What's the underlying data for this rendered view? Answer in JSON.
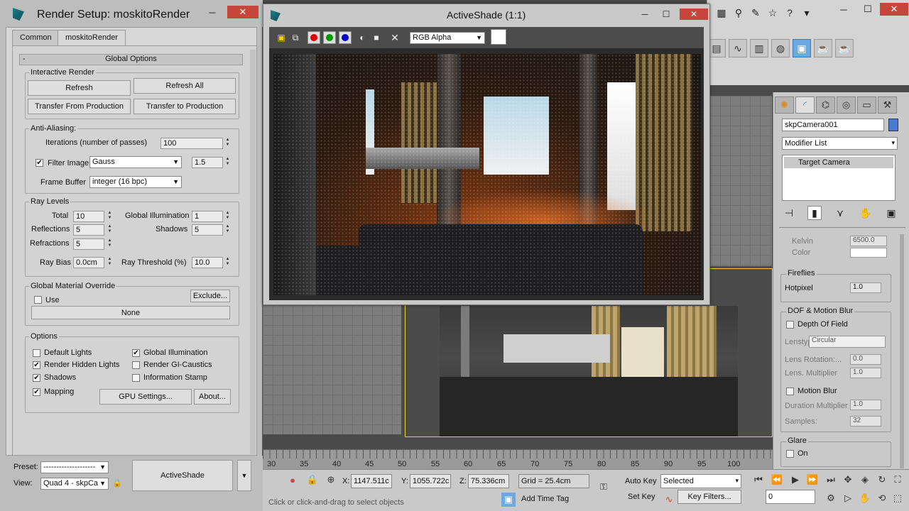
{
  "render_setup": {
    "title": "Render Setup: moskitoRender",
    "tabs": [
      "Common",
      "moskitoRender"
    ],
    "rollout_title": "Global Options",
    "interactive_render": {
      "title": "Interactive Render",
      "refresh": "Refresh",
      "refresh_all": "Refresh All",
      "transfer_from": "Transfer From Production",
      "transfer_to": "Transfer to Production"
    },
    "anti_aliasing": {
      "title": "Anti-Aliasing:",
      "iterations_label": "Iterations (number of passes)",
      "iterations_value": "100",
      "filter_image_label": "Filter Image",
      "filter_value": "Gauss",
      "filter_size": "1.5",
      "frame_buffer_label": "Frame Buffer",
      "frame_buffer_value": "integer (16 bpc)"
    },
    "ray_levels": {
      "title": "Ray Levels",
      "total_label": "Total",
      "total_value": "10",
      "gi_label": "Global Illumination",
      "gi_value": "1",
      "reflections_label": "Reflections",
      "reflections_value": "5",
      "shadows_label": "Shadows",
      "shadows_value": "5",
      "refractions_label": "Refractions",
      "refractions_value": "5",
      "ray_bias_label": "Ray Bias",
      "ray_bias_value": "0.0cm",
      "ray_threshold_label": "Ray Threshold (%)",
      "ray_threshold_value": "10.0"
    },
    "material_override": {
      "title": "Global Material Override",
      "exclude": "Exclude...",
      "use_label": "Use",
      "none_button": "None"
    },
    "options": {
      "title": "Options",
      "default_lights": "Default Lights",
      "global_illumination": "Global Illumination",
      "render_hidden_lights": "Render Hidden Lights",
      "render_gi_caustics": "Render GI-Caustics",
      "shadows": "Shadows",
      "information_stamp": "Information Stamp",
      "mapping": "Mapping",
      "gpu_settings": "GPU Settings...",
      "about": "About..."
    },
    "bottom": {
      "preset_label": "Preset:",
      "preset_value": "--------------------",
      "view_label": "View:",
      "view_value": "Quad 4 - skpCa",
      "render_button": "ActiveShade"
    }
  },
  "activeshade": {
    "title": "ActiveShade (1:1)",
    "channel": "RGB Alpha"
  },
  "timeline": {
    "labels": [
      "30",
      "35",
      "40",
      "45",
      "50",
      "55",
      "60",
      "65",
      "70",
      "75",
      "80",
      "85",
      "90",
      "95",
      "100"
    ]
  },
  "status_bar": {
    "x_label": "X:",
    "x_value": "1147.511c",
    "y_label": "Y:",
    "y_value": "1055.722c",
    "z_label": "Z:",
    "z_value": "75.336cm",
    "grid": "Grid = 25.4cm",
    "auto_key": "Auto Key",
    "set_key": "Set Key",
    "selected": "Selected",
    "key_filters": "Key Filters...",
    "add_time_tag": "Add Time Tag",
    "prompt": "Click or click-and-drag to select objects",
    "frame_value": "0"
  },
  "command_panel": {
    "object_name": "skpCamera001",
    "modifier_list": "Modifier List",
    "stack_item": "Target Camera",
    "kelvin_label": "Kelvin",
    "kelvin_value": "6500.0",
    "color_label": "Color",
    "fireflies_title": "Fireflies",
    "hotpixel_label": "Hotpixel",
    "hotpixel_value": "1.0",
    "dof_title": "DOF & Motion Blur",
    "depth_of_field": "Depth Of Field",
    "lenstype_label": "Lenstype:",
    "lenstype_value": "Circular",
    "lens_rotation_label": "Lens Rotation:...",
    "lens_rotation_value": "0.0",
    "lens_multiplier_label": "Lens. Multiplier",
    "lens_multiplier_value": "1.0",
    "motion_blur": "Motion Blur",
    "duration_multiplier_label": "Duration Multiplier",
    "duration_multiplier_value": "1.0",
    "samples_label": "Samples:",
    "samples_value": "32",
    "glare_title": "Glare",
    "on_label": "On"
  },
  "colors": {
    "title_close": "#c7463c",
    "accent_blue": "#6ca9e0",
    "viewport_highlight": "#e4d33a"
  }
}
